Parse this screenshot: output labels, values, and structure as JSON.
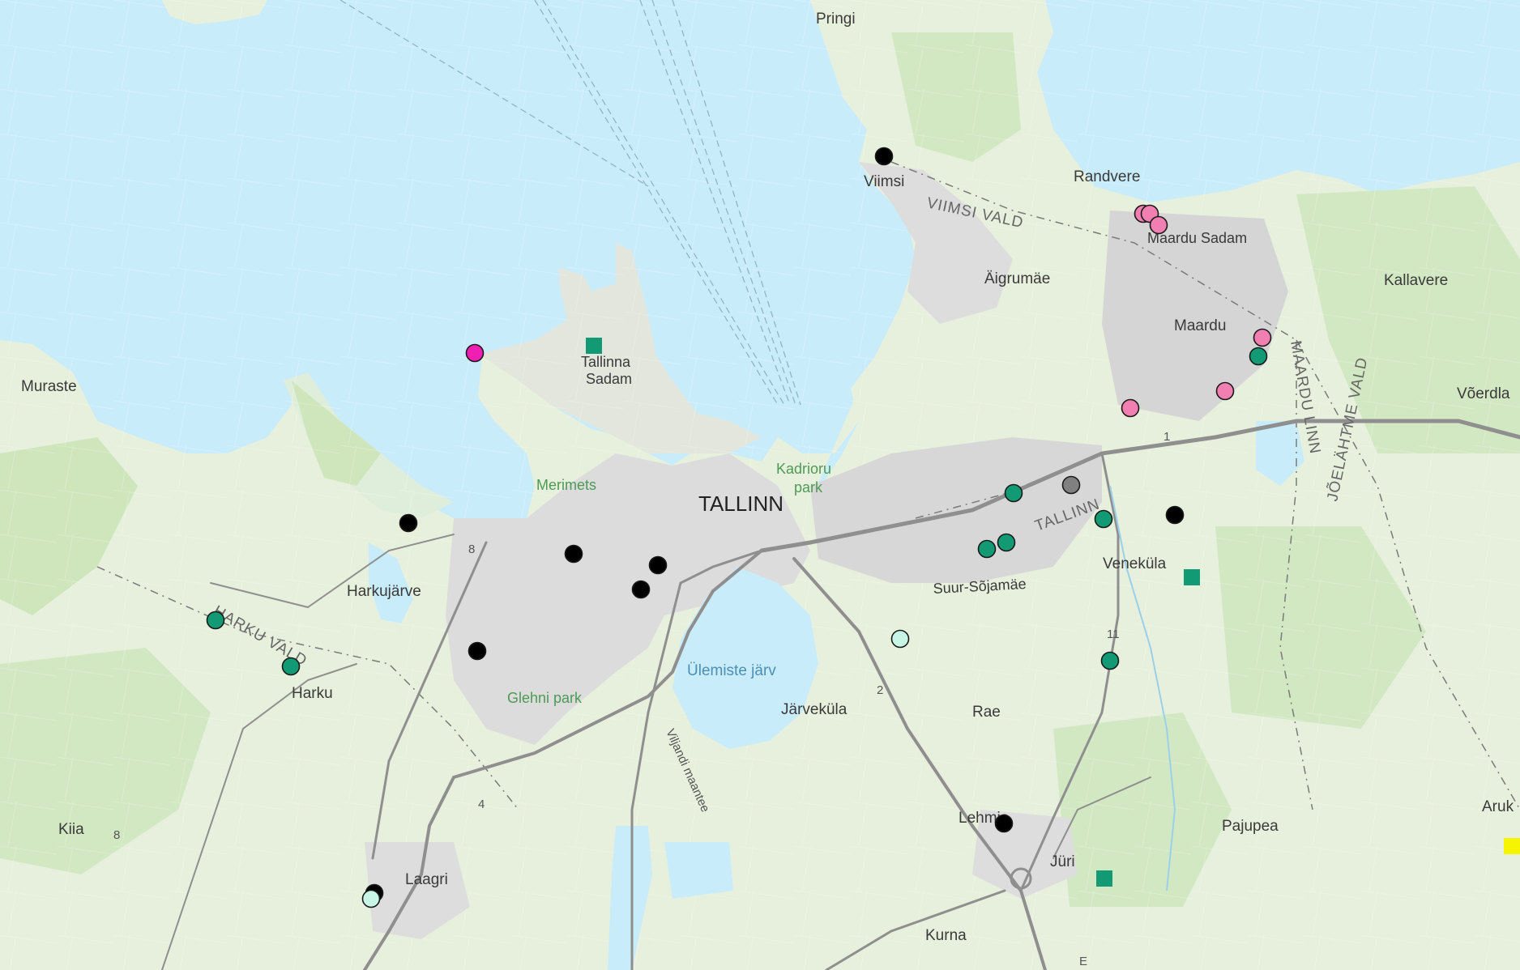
{
  "map": {
    "city_label": "TALLINN",
    "places": [
      {
        "id": "pringi",
        "label": "Pringi"
      },
      {
        "id": "viimsi",
        "label": "Viimsi"
      },
      {
        "id": "randvere",
        "label": "Randvere"
      },
      {
        "id": "maardu-sadam",
        "label": "Maardu Sadam"
      },
      {
        "id": "aigrumae",
        "label": "Äigrumäe"
      },
      {
        "id": "kallavere",
        "label": "Kallavere"
      },
      {
        "id": "maardu",
        "label": "Maardu"
      },
      {
        "id": "voerdla",
        "label": "Võerdla"
      },
      {
        "id": "muraste",
        "label": "Muraste"
      },
      {
        "id": "tallinna-sadam-1",
        "label": "Tallinna"
      },
      {
        "id": "tallinna-sadam-2",
        "label": "Sadam"
      },
      {
        "id": "harkujarve",
        "label": "Harkujärve"
      },
      {
        "id": "harku",
        "label": "Harku"
      },
      {
        "id": "veneküla",
        "label": "Veneküla"
      },
      {
        "id": "suur-sojamae",
        "label": "Suur-Sõjamäe"
      },
      {
        "id": "jarvekula",
        "label": "Järveküla"
      },
      {
        "id": "rae",
        "label": "Rae"
      },
      {
        "id": "kiia",
        "label": "Kiia"
      },
      {
        "id": "laagri",
        "label": "Laagri"
      },
      {
        "id": "lehmja",
        "label": "Lehmja"
      },
      {
        "id": "pajupea",
        "label": "Pajupea"
      },
      {
        "id": "aruk",
        "label": "Aruk"
      },
      {
        "id": "juri",
        "label": "Jüri"
      },
      {
        "id": "kurna",
        "label": "Kurna"
      }
    ],
    "parks": [
      {
        "id": "merimets",
        "label": "Merimets"
      },
      {
        "id": "kadriorg-1",
        "label": "Kadrioru"
      },
      {
        "id": "kadriorg-2",
        "label": "park"
      },
      {
        "id": "glehni",
        "label": "Glehni park"
      },
      {
        "id": "ulemiste",
        "label": "Ülemiste järv"
      }
    ],
    "districts": [
      {
        "id": "viimsi-vald",
        "label": "VIIMSI VALD"
      },
      {
        "id": "harku-vald",
        "label": "HARKU VALD"
      },
      {
        "id": "tallinn-border",
        "label": "TALLINN"
      },
      {
        "id": "maardu-linn",
        "label": "MAARDU LINN"
      },
      {
        "id": "joelahtme-vald",
        "label": "JÕELÄHTME VALD"
      }
    ],
    "roads": [
      {
        "id": "road-viljandi",
        "label": "Viljandi maantee"
      },
      {
        "id": "road-8a",
        "label": "8"
      },
      {
        "id": "road-8b",
        "label": "8"
      },
      {
        "id": "road-4",
        "label": "4"
      },
      {
        "id": "road-2",
        "label": "2"
      },
      {
        "id": "road-1",
        "label": "1"
      },
      {
        "id": "road-11",
        "label": "11"
      },
      {
        "id": "road-e",
        "label": "E"
      }
    ],
    "marker_colors": {
      "black": "#000000",
      "green": "#119a73",
      "pink": "#f17fb1",
      "magenta": "#f01fb4",
      "mint": "#c8f6e6",
      "gray": "#808080",
      "yellow": "#f7f400"
    },
    "markers": [
      {
        "id": "m-viimsi",
        "color": "black",
        "shape": "circle"
      },
      {
        "id": "m-harkujarve",
        "color": "black",
        "shape": "circle"
      },
      {
        "id": "m-center-1",
        "color": "black",
        "shape": "circle"
      },
      {
        "id": "m-center-2",
        "color": "black",
        "shape": "circle"
      },
      {
        "id": "m-center-3",
        "color": "black",
        "shape": "circle"
      },
      {
        "id": "m-mustamae",
        "color": "black",
        "shape": "circle"
      },
      {
        "id": "m-east",
        "color": "black",
        "shape": "circle"
      },
      {
        "id": "m-lehmja",
        "color": "black",
        "shape": "circle"
      },
      {
        "id": "m-laagri-black",
        "color": "black",
        "shape": "circle"
      },
      {
        "id": "m-harku-1",
        "color": "green",
        "shape": "circle"
      },
      {
        "id": "m-harku-2",
        "color": "green",
        "shape": "circle"
      },
      {
        "id": "m-maardu-green",
        "color": "green",
        "shape": "circle"
      },
      {
        "id": "m-lasnamae-1",
        "color": "green",
        "shape": "circle"
      },
      {
        "id": "m-lasnamae-2",
        "color": "green",
        "shape": "circle"
      },
      {
        "id": "m-lasnamae-3",
        "color": "green",
        "shape": "circle"
      },
      {
        "id": "m-lasnamae-4",
        "color": "green",
        "shape": "circle"
      },
      {
        "id": "m-rae-green",
        "color": "green",
        "shape": "circle"
      },
      {
        "id": "m-randvere-1",
        "color": "pink",
        "shape": "circle"
      },
      {
        "id": "m-randvere-2",
        "color": "pink",
        "shape": "circle"
      },
      {
        "id": "m-randvere-3",
        "color": "pink",
        "shape": "circle"
      },
      {
        "id": "m-maardu-pink-1",
        "color": "pink",
        "shape": "circle"
      },
      {
        "id": "m-maardu-pink-2",
        "color": "pink",
        "shape": "circle"
      },
      {
        "id": "m-maardu-pink-3",
        "color": "pink",
        "shape": "circle"
      },
      {
        "id": "m-kopli",
        "color": "magenta",
        "shape": "circle"
      },
      {
        "id": "m-ulemiste",
        "color": "mint",
        "shape": "circle"
      },
      {
        "id": "m-laagri-mint",
        "color": "mint",
        "shape": "circle"
      },
      {
        "id": "m-lasnamae-gray",
        "color": "gray",
        "shape": "circle"
      },
      {
        "id": "sq-sadam",
        "color": "green",
        "shape": "square"
      },
      {
        "id": "sq-venekula",
        "color": "green",
        "shape": "square"
      },
      {
        "id": "sq-juri",
        "color": "green",
        "shape": "square"
      },
      {
        "id": "sq-aruk",
        "color": "yellow",
        "shape": "square"
      }
    ]
  }
}
